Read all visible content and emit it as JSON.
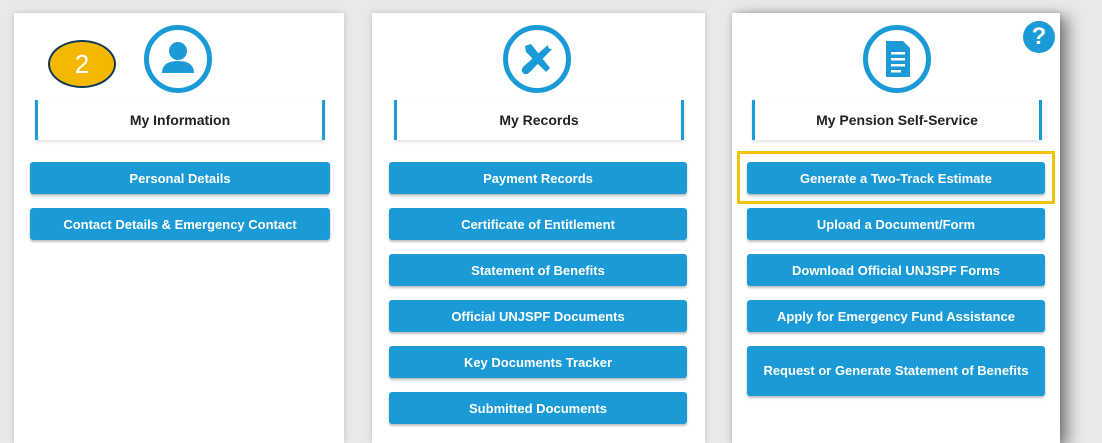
{
  "colors": {
    "accent": "#1a9ad6",
    "badge": "#f5b800",
    "highlight": "#f5c20a",
    "button_text": "#ffffff"
  },
  "badge": {
    "number": "2"
  },
  "help": {
    "icon": "question-icon",
    "symbol": "?"
  },
  "info": {
    "title": "My Information",
    "icon": "person-icon",
    "buttons": [
      "Personal Details",
      "Contact Details & Emergency Contact"
    ]
  },
  "records": {
    "title": "My Records",
    "icon": "tools-icon",
    "buttons": [
      "Payment Records",
      "Certificate of Entitlement",
      "Statement of Benefits",
      "Official UNJSPF Documents",
      "Key Documents Tracker",
      "Submitted Documents"
    ]
  },
  "pension": {
    "title": "My Pension Self-Service",
    "icon": "document-icon",
    "buttons": [
      "Generate a Two-Track Estimate",
      "Upload a Document/Form",
      "Download Official UNJSPF Forms",
      "Apply for Emergency Fund Assistance",
      "Request or Generate Statement of Benefits"
    ]
  }
}
